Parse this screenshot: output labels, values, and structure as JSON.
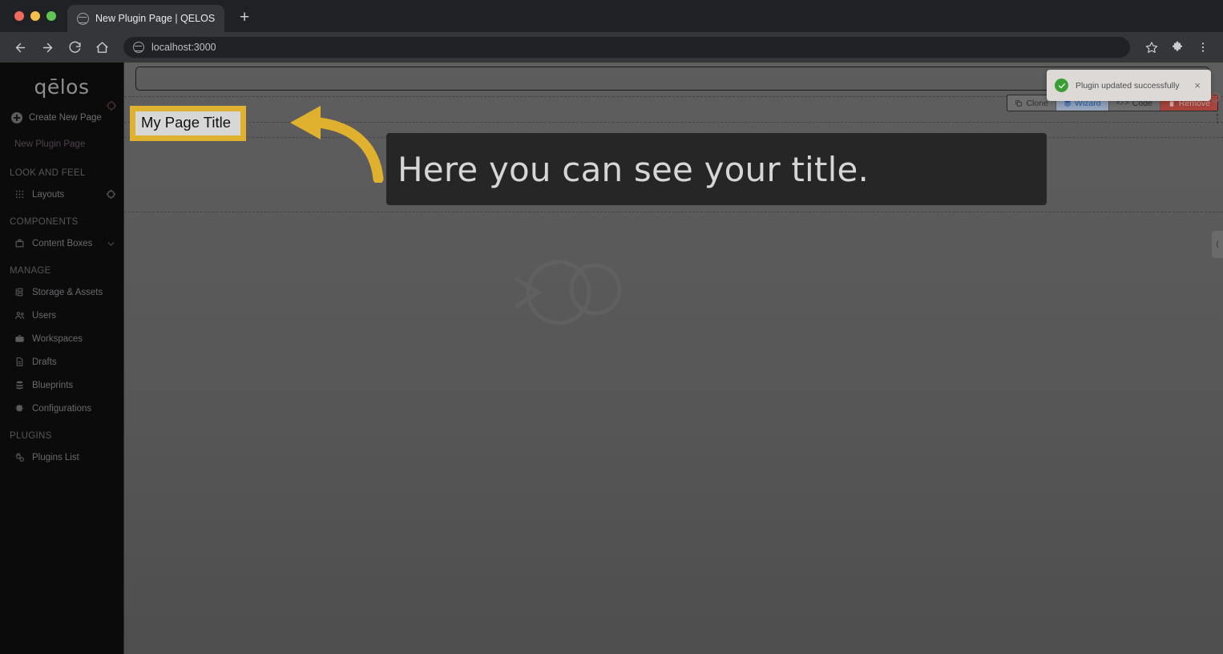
{
  "browser": {
    "tab": {
      "title": "New Plugin Page | QELOS",
      "favicon": "globe-icon"
    },
    "new_tab_label": "+",
    "address": "localhost:3000",
    "nav": {
      "back": "back-arrow-icon",
      "forward": "forward-arrow-icon",
      "reload": "reload-icon",
      "home": "home-icon",
      "bookmark": "star-icon",
      "extensions": "puzzle-piece-icon",
      "menu": "three-dot-menu-icon"
    }
  },
  "sidebar": {
    "logo": "qēlos",
    "create_new_page": "Create New Page",
    "current_page": "New Plugin Page",
    "sections": [
      {
        "label": "LOOK AND FEEL",
        "items": [
          {
            "label": "Layouts",
            "icon": "grid-icon",
            "trailing": "puzzle-piece-icon"
          }
        ]
      },
      {
        "label": "COMPONENTS",
        "items": [
          {
            "label": "Content Boxes",
            "icon": "box-icon",
            "trailing": "chevron-down-icon"
          }
        ]
      },
      {
        "label": "MANAGE",
        "items": [
          {
            "label": "Storage & Assets",
            "icon": "storage-icon",
            "trailing": ""
          },
          {
            "label": "Users",
            "icon": "users-icon",
            "trailing": ""
          },
          {
            "label": "Workspaces",
            "icon": "briefcase-icon",
            "trailing": ""
          },
          {
            "label": "Drafts",
            "icon": "document-icon",
            "trailing": ""
          },
          {
            "label": "Blueprints",
            "icon": "database-icon",
            "trailing": ""
          },
          {
            "label": "Configurations",
            "icon": "gear-icon",
            "trailing": ""
          }
        ]
      },
      {
        "label": "PLUGINS",
        "items": [
          {
            "label": "Plugins List",
            "icon": "plug-icon",
            "trailing": ""
          }
        ]
      }
    ]
  },
  "editor": {
    "top_input_value": "",
    "page_title": "My Page Title",
    "actions": [
      {
        "label": "Clone",
        "icon": "copy-icon",
        "state": "default"
      },
      {
        "label": "Wizard",
        "icon": "layers-icon",
        "state": "active"
      },
      {
        "label": "Code",
        "icon": "code-icon",
        "state": "default"
      },
      {
        "label": "Remove",
        "icon": "trash-icon",
        "state": "danger"
      }
    ],
    "right_puzzle_icon": "puzzle-piece-icon",
    "kebab_icon": "vertical-dots-icon",
    "collapse_handle_icon": "chevron-left-icon"
  },
  "annotation": {
    "callout_text": "Here you can see your title.",
    "highlight_color": "#e0b12e",
    "arrow_color": "#e0b12e",
    "callout_bg": "#262626"
  },
  "toast": {
    "message": "Plugin updated successfully",
    "status": "success",
    "status_color": "#3a9e33",
    "close_label": "×"
  }
}
